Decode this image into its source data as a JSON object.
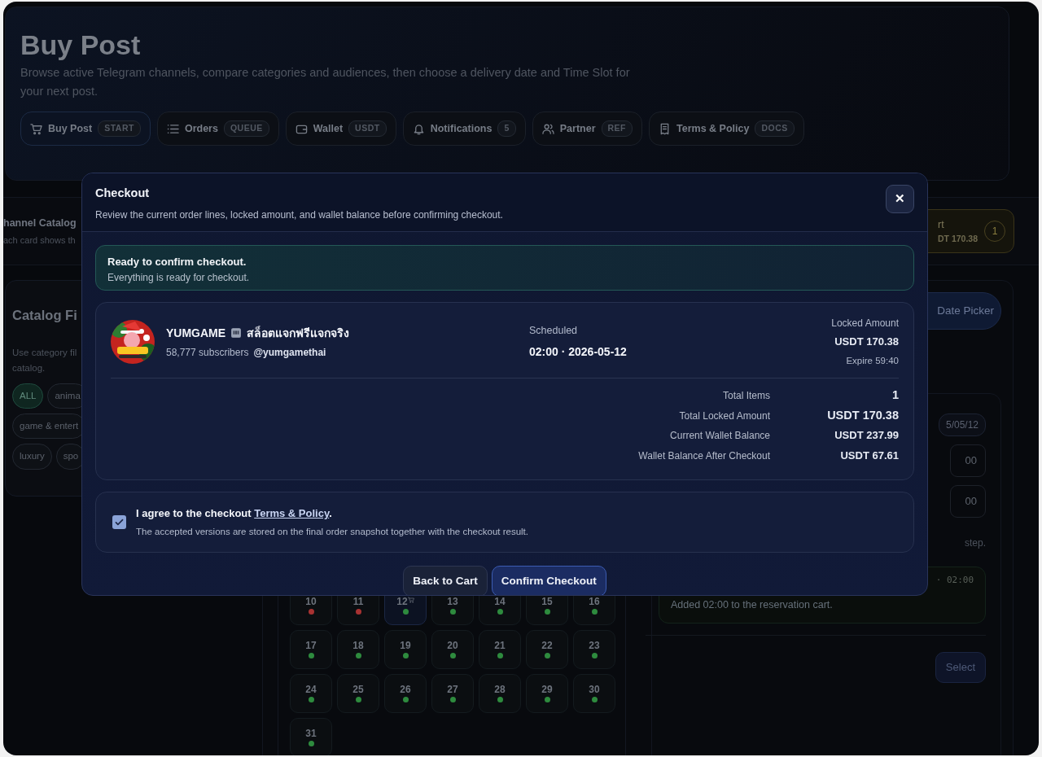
{
  "header": {
    "title": "Buy Post",
    "description": "Browse active Telegram channels, compare categories and audiences, then choose a delivery date and Time Slot for your next post.",
    "nav": [
      {
        "label": "Buy Post",
        "tag": "START",
        "selected": true
      },
      {
        "label": "Orders",
        "tag": "QUEUE",
        "selected": false
      },
      {
        "label": "Wallet",
        "tag": "USDT",
        "selected": false
      },
      {
        "label": "Notifications",
        "tag": "5",
        "selected": false
      },
      {
        "label": "Partner",
        "tag": "REF",
        "selected": false
      },
      {
        "label": "Terms & Policy",
        "tag": "DOCS",
        "selected": false
      }
    ]
  },
  "catalog_bar": {
    "title": "hannel Catalog",
    "subtitle": "ach card shows th"
  },
  "cart_widget": {
    "title": "rt",
    "amount": "DT 170.38",
    "count": "1"
  },
  "filters": {
    "title": "Catalog Fi",
    "description_lines": [
      "Use category fil",
      "catalog."
    ],
    "chips": [
      {
        "label": "ALL",
        "selected": true
      },
      {
        "label": "anima",
        "selected": false
      },
      {
        "label": "game & entert",
        "selected": false
      },
      {
        "label": "luxury",
        "selected": false
      },
      {
        "label": "spo",
        "selected": false
      }
    ]
  },
  "calendar": {
    "days": [
      {
        "label": "10",
        "selected": false,
        "in_cart": false,
        "color": "#a83232"
      },
      {
        "label": "11",
        "selected": false,
        "in_cart": false,
        "color": "#a83232"
      },
      {
        "label": "12",
        "selected": true,
        "in_cart": true,
        "color": "#2e8b3e"
      },
      {
        "label": "13",
        "selected": false,
        "in_cart": false,
        "color": "#2e8b3e"
      },
      {
        "label": "14",
        "selected": false,
        "in_cart": false,
        "color": "#2e8b3e"
      },
      {
        "label": "15",
        "selected": false,
        "in_cart": false,
        "color": "#2e8b3e"
      },
      {
        "label": "16",
        "selected": false,
        "in_cart": false,
        "color": "#2e8b3e"
      },
      {
        "label": "17",
        "selected": false,
        "in_cart": false,
        "color": "#2e8b3e"
      },
      {
        "label": "18",
        "selected": false,
        "in_cart": false,
        "color": "#2e8b3e"
      },
      {
        "label": "19",
        "selected": false,
        "in_cart": false,
        "color": "#2e8b3e"
      },
      {
        "label": "20",
        "selected": false,
        "in_cart": false,
        "color": "#2e8b3e"
      },
      {
        "label": "21",
        "selected": false,
        "in_cart": false,
        "color": "#2e8b3e"
      },
      {
        "label": "22",
        "selected": false,
        "in_cart": false,
        "color": "#2e8b3e"
      },
      {
        "label": "23",
        "selected": false,
        "in_cart": false,
        "color": "#2e8b3e"
      },
      {
        "label": "24",
        "selected": false,
        "in_cart": false,
        "color": "#2e8b3e"
      },
      {
        "label": "25",
        "selected": false,
        "in_cart": false,
        "color": "#2e8b3e"
      },
      {
        "label": "26",
        "selected": false,
        "in_cart": false,
        "color": "#2e8b3e"
      },
      {
        "label": "27",
        "selected": false,
        "in_cart": false,
        "color": "#2e8b3e"
      },
      {
        "label": "28",
        "selected": false,
        "in_cart": false,
        "color": "#2e8b3e"
      },
      {
        "label": "29",
        "selected": false,
        "in_cart": false,
        "color": "#2e8b3e"
      },
      {
        "label": "30",
        "selected": false,
        "in_cart": false,
        "color": "#2e8b3e"
      },
      {
        "label": "31",
        "selected": false,
        "in_cart": false,
        "color": "#2e8b3e"
      }
    ]
  },
  "right_panel": {
    "date_picker_button": "Date Picker",
    "date_pill": "5/05/12",
    "slot_values": [
      "00",
      "00"
    ],
    "hint": "step.",
    "log": {
      "time": "· 02:00",
      "message": "Added 02:00 to the reservation cart."
    },
    "select_button": "Select"
  },
  "checkout": {
    "title": "Checkout",
    "subtitle": "Review the current order lines, locked amount, and wallet balance before confirming checkout.",
    "close": "✕",
    "alert": {
      "title": "Ready to confirm checkout.",
      "message": "Everything is ready for checkout."
    },
    "items": [
      {
        "name": "YUMGAME",
        "name_thai": "สล็อตแจกฟรีแจกจริง",
        "subscribers": "58,777 subscribers",
        "handle": "@yumgamethai",
        "scheduled_label": "Scheduled",
        "scheduled": "02:00 · 2026-05-12",
        "locked_label": "Locked Amount",
        "locked_amount": "USDT 170.38",
        "expire": "Expire 59:40"
      }
    ],
    "summary": [
      {
        "label": "Total Items",
        "value": "1",
        "emphasis": true
      },
      {
        "label": "Total Locked Amount",
        "value": "USDT 170.38",
        "emphasis": true
      },
      {
        "label": "Current Wallet Balance",
        "value": "USDT 237.99",
        "emphasis": false
      },
      {
        "label": "Wallet Balance After Checkout",
        "value": "USDT 67.61",
        "emphasis": false
      }
    ],
    "terms": {
      "checked": true,
      "text_before": "I agree to the checkout ",
      "link": "Terms & Policy",
      "text_after": ".",
      "note": "The accepted versions are stored on the final order snapshot together with the checkout result."
    },
    "buttons": [
      {
        "label": "Back to Cart",
        "kind": "secondary"
      },
      {
        "label": "Confirm Checkout",
        "kind": "primary"
      }
    ]
  }
}
